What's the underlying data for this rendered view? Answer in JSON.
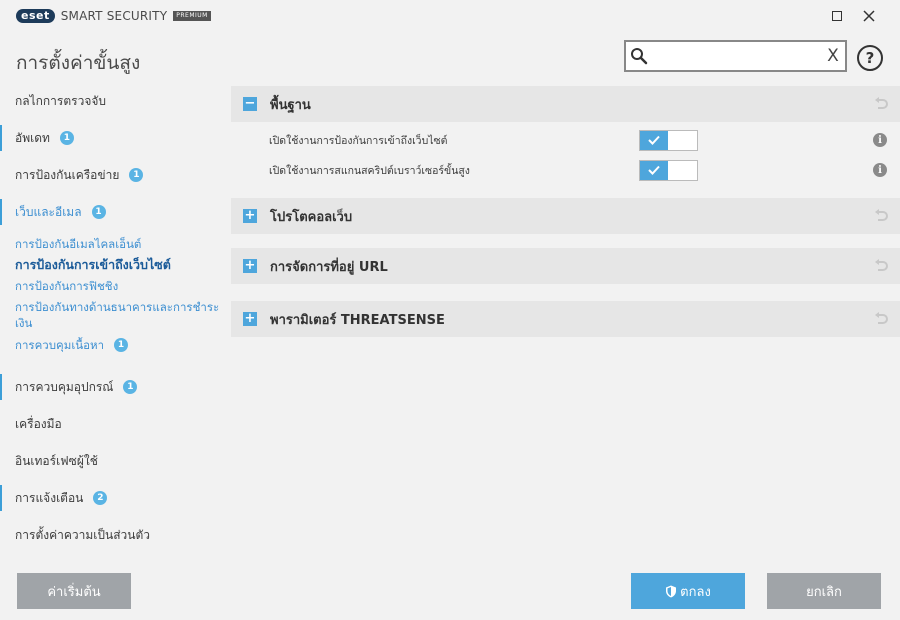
{
  "app": {
    "brand": "eset",
    "product": "SMART SECURITY",
    "edition": "PREMIUM"
  },
  "header": {
    "title": "การตั้งค่าขั้นสูง",
    "search_value": "",
    "clear_label": "X",
    "help_label": "?"
  },
  "sidebar": {
    "items": [
      {
        "label": "กลไกการตรวจจับ",
        "badge": null
      },
      {
        "label": "อัพเดท",
        "badge": "1"
      },
      {
        "label": "การป้องกันเครือข่าย",
        "badge": "1"
      },
      {
        "label": "เว็บและอีเมล",
        "badge": "1"
      },
      {
        "label": "การควบคุมอุปกรณ์",
        "badge": "1"
      },
      {
        "label": "เครื่องมือ",
        "badge": null
      },
      {
        "label": "อินเทอร์เฟซผู้ใช้",
        "badge": null
      },
      {
        "label": "การแจ้งเตือน",
        "badge": "2"
      },
      {
        "label": "การตั้งค่าความเป็นส่วนตัว",
        "badge": null
      }
    ],
    "sub_items": [
      {
        "label": "การป้องกันอีเมลไคลเอ็นต์"
      },
      {
        "label": "การป้องกันการเข้าถึงเว็บไซต์"
      },
      {
        "label": "การป้องกันการฟิชชิง"
      },
      {
        "label": "การป้องกันทางด้านธนาคารและการชำระเงิน"
      },
      {
        "label": "การควบคุมเนื้อหา",
        "badge": "1"
      }
    ]
  },
  "main": {
    "sections": [
      {
        "title": "พื้นฐาน",
        "expanded": true
      },
      {
        "title": "โปรโตคอลเว็บ",
        "expanded": false
      },
      {
        "title": "การจัดการที่อยู่ URL",
        "expanded": false
      },
      {
        "title": "พารามิเตอร์ THREATSENSE",
        "expanded": false
      }
    ],
    "settings": [
      {
        "label": "เปิดใช้งานการป้องกันการเข้าถึงเว็บไซต์",
        "enabled": true
      },
      {
        "label": "เปิดใช้งานการสแกนสคริปต์เบราว์เซอร์ขั้นสูง",
        "enabled": true
      }
    ],
    "expanded_symbol": "−",
    "collapsed_symbol": "+",
    "info_symbol": "i"
  },
  "footer": {
    "default_label": "ค่าเริ่มต้น",
    "ok_label": "ตกลง",
    "cancel_label": "ยกเลิก"
  },
  "colors": {
    "accent": "#4ea6dc",
    "link": "#3d8fd1",
    "active_link": "#1b5b99",
    "badge": "#5ab4e4",
    "gray_button": "#a0a4a8"
  }
}
